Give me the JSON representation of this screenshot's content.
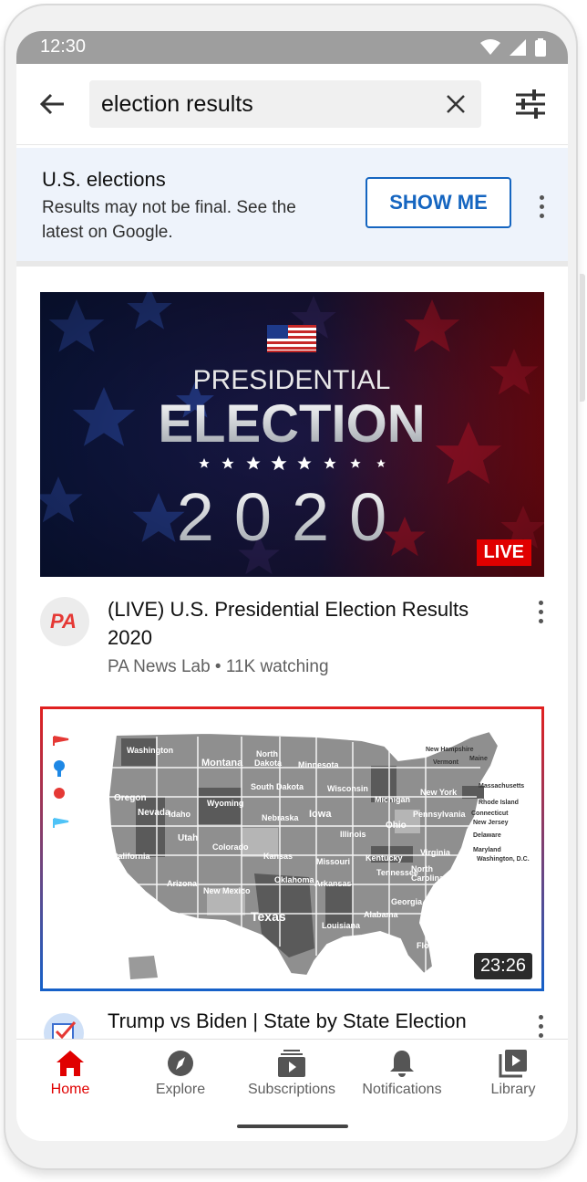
{
  "status_bar": {
    "time": "12:30"
  },
  "search": {
    "query": "election results"
  },
  "banner": {
    "title": "U.S. elections",
    "description": "Results may not be final. See the latest on Google.",
    "button_label": "SHOW ME"
  },
  "videos": [
    {
      "thumbnail_text": {
        "line1": "PRESIDENTIAL",
        "line2": "ELECTION",
        "year": "2020"
      },
      "badge": "LIVE",
      "channel_avatar_text": "PA",
      "title": "(LIVE) U.S. Presidential Election Results 2020",
      "meta": "PA News Lab • 11K watching"
    },
    {
      "duration": "23:26",
      "map_labels": [
        "Washington",
        "Montana",
        "North Dakota",
        "Minnesota",
        "Oregon",
        "Idaho",
        "South Dakota",
        "Wisconsin",
        "Michigan",
        "New York",
        "Wyoming",
        "Nebraska",
        "Iowa",
        "Nevada",
        "Utah",
        "Colorado",
        "Kansas",
        "Missouri",
        "Illinois",
        "Ohio",
        "Pennsylvania",
        "California",
        "Arizona",
        "New Mexico",
        "Oklahoma",
        "Arkansas",
        "Kentucky",
        "Virginia",
        "Tennessee",
        "North Carolina",
        "Texas",
        "Georgia",
        "Alabama",
        "Louisiana",
        "Florida",
        "Maine",
        "Vermont",
        "New Hampshire",
        "Massachusetts",
        "Rhode Island",
        "Connecticut",
        "New Jersey",
        "Delaware",
        "Maryland",
        "Washington, D.C."
      ],
      "title": "Trump vs Biden | State by State Election"
    }
  ],
  "nav": [
    {
      "label": "Home",
      "icon": "home-icon",
      "active": true
    },
    {
      "label": "Explore",
      "icon": "compass-icon"
    },
    {
      "label": "Subscriptions",
      "icon": "subscriptions-icon"
    },
    {
      "label": "Notifications",
      "icon": "bell-icon"
    },
    {
      "label": "Library",
      "icon": "library-icon"
    }
  ],
  "colors": {
    "accent": "#e00000",
    "link": "#1565c0",
    "banner_bg": "#eef3fb"
  }
}
